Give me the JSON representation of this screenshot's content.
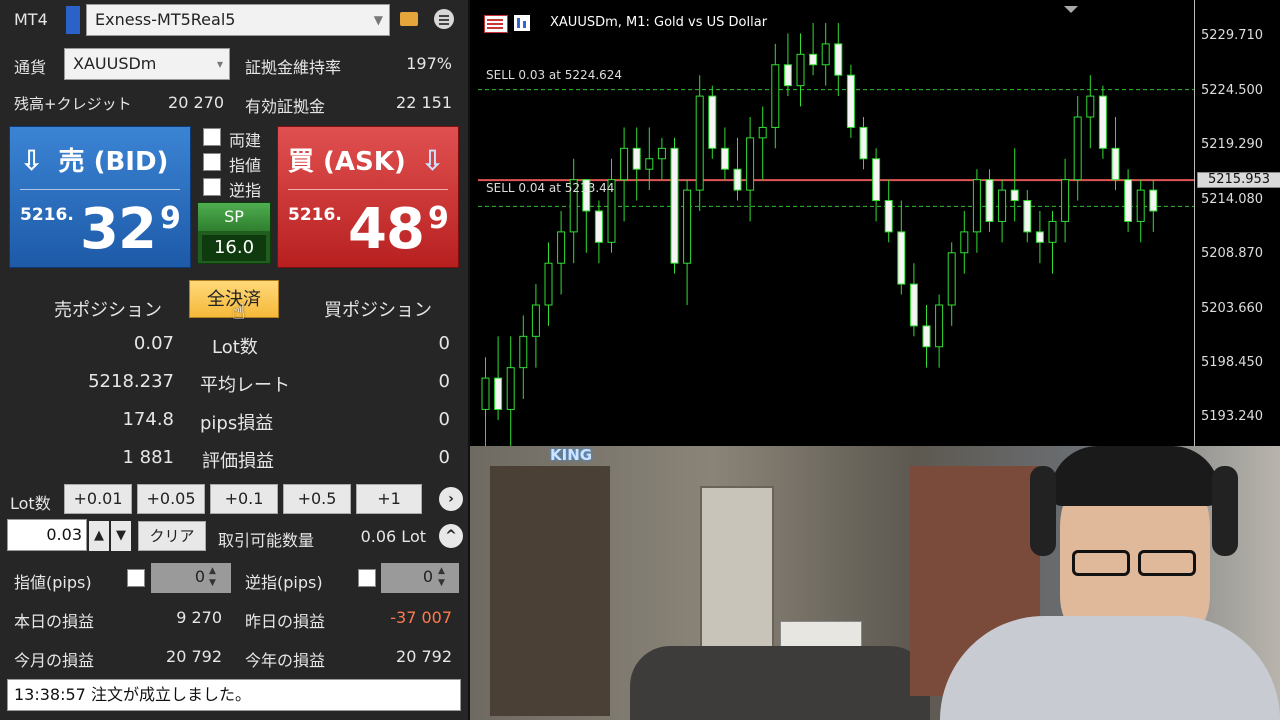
{
  "panel": {
    "app_label": "MT4",
    "account": "Exness-MT5Real5",
    "currency_label": "通貨",
    "symbol": "XAUUSDm",
    "margin_rate_label": "証拠金維持率",
    "margin_rate": "197%",
    "balance_label": "残高+クレジット",
    "balance": "20 270",
    "effective_margin_label": "有効証拠金",
    "effective_margin": "22 151",
    "bid": {
      "title": "売 (BID)",
      "small": "5216.",
      "big": "32",
      "sup": "9"
    },
    "ask": {
      "title": "買 (ASK)",
      "small": "5216.",
      "big": "48",
      "sup": "9"
    },
    "options": [
      {
        "label": "両建",
        "checked": false
      },
      {
        "label": "指値",
        "checked": false
      },
      {
        "label": "逆指",
        "checked": false
      }
    ],
    "spread": {
      "label": "SP",
      "value": "16.0"
    },
    "close_all": "全決済",
    "sell_position_label": "売ポジション",
    "buy_position_label": "買ポジション",
    "position_rows": [
      {
        "sell": "0.07",
        "label": "Lot数",
        "buy": "0"
      },
      {
        "sell": "5218.237",
        "label": "平均レート",
        "buy": "0"
      },
      {
        "sell": "174.8",
        "label": "pips損益",
        "buy": "0"
      },
      {
        "sell": "1 881",
        "label": "評価損益",
        "buy": "0"
      }
    ],
    "lot_label": "Lot数",
    "lot_buttons": [
      "+0.01",
      "+0.05",
      "+0.1",
      "+0.5",
      "+1"
    ],
    "lot_value": "0.03",
    "clear_label": "クリア",
    "tradable_label": "取引可能数量",
    "tradable_value": "0.06 Lot",
    "limit_label": "指値(pips)",
    "limit_value": "0",
    "stop_label": "逆指(pips)",
    "stop_value": "0",
    "today_pl_label": "本日の損益",
    "today_pl": "9 270",
    "yesterday_pl_label": "昨日の損益",
    "yesterday_pl": "-37 007",
    "month_pl_label": "今月の損益",
    "month_pl": "20 792",
    "year_pl_label": "今年の損益",
    "year_pl": "20 792",
    "status": "13:38:57 注文が成立しました。",
    "colors": {
      "negative": "#ff7a4d",
      "bid": "#1d5aa8",
      "ask": "#b82020"
    }
  },
  "chart": {
    "title": "XAUUSDm, M1:  Gold vs US Dollar",
    "order_lines": [
      {
        "label": "SELL 0.03 at 5224.624",
        "price": 5224.624
      },
      {
        "label": "SELL 0.04 at 5213.44",
        "price": 5213.44
      }
    ],
    "current_price_label": "5215.953",
    "chart_data": {
      "type": "candlestick",
      "y_ticks": [
        "5229.710",
        "5224.500",
        "5219.290",
        "5214.080",
        "5208.870",
        "5203.660",
        "5198.450",
        "5193.240"
      ],
      "ylim": [
        5190.5,
        5233.2
      ],
      "current_price": 5215.953,
      "candles": [
        [
          5194,
          5199,
          5190,
          5197
        ],
        [
          5197,
          5201,
          5193,
          5194
        ],
        [
          5194,
          5201,
          5190,
          5198
        ],
        [
          5198,
          5203,
          5195,
          5201
        ],
        [
          5201,
          5206,
          5198,
          5204
        ],
        [
          5204,
          5210,
          5202,
          5208
        ],
        [
          5208,
          5213,
          5205,
          5211
        ],
        [
          5211,
          5218,
          5208,
          5216
        ],
        [
          5216,
          5216,
          5209,
          5213
        ],
        [
          5213,
          5214,
          5208,
          5210
        ],
        [
          5210,
          5218,
          5209,
          5216
        ],
        [
          5216,
          5221,
          5212,
          5219
        ],
        [
          5219,
          5221,
          5214,
          5217
        ],
        [
          5217,
          5221,
          5215,
          5218
        ],
        [
          5218,
          5220,
          5216,
          5219
        ],
        [
          5219,
          5220,
          5207,
          5208
        ],
        [
          5208,
          5216,
          5204,
          5215
        ],
        [
          5215,
          5226,
          5213,
          5224
        ],
        [
          5224,
          5225,
          5218,
          5219
        ],
        [
          5219,
          5221,
          5216,
          5217
        ],
        [
          5217,
          5220,
          5214,
          5215
        ],
        [
          5215,
          5222,
          5212,
          5220
        ],
        [
          5220,
          5223,
          5216,
          5221
        ],
        [
          5221,
          5229,
          5219,
          5227
        ],
        [
          5227,
          5230,
          5224,
          5225
        ],
        [
          5225,
          5230,
          5223,
          5228
        ],
        [
          5228,
          5231,
          5226,
          5227
        ],
        [
          5227,
          5231,
          5225,
          5229
        ],
        [
          5229,
          5231,
          5224,
          5226
        ],
        [
          5226,
          5227,
          5220,
          5221
        ],
        [
          5221,
          5222,
          5217,
          5218
        ],
        [
          5218,
          5219,
          5212,
          5214
        ],
        [
          5214,
          5216,
          5210,
          5211
        ],
        [
          5211,
          5214,
          5205,
          5206
        ],
        [
          5206,
          5208,
          5201,
          5202
        ],
        [
          5202,
          5204,
          5198,
          5200
        ],
        [
          5200,
          5205,
          5198,
          5204
        ],
        [
          5204,
          5210,
          5202,
          5209
        ],
        [
          5209,
          5213,
          5207,
          5211
        ],
        [
          5211,
          5217,
          5209,
          5216
        ],
        [
          5216,
          5217,
          5211,
          5212
        ],
        [
          5212,
          5216,
          5210,
          5215
        ],
        [
          5215,
          5219,
          5212,
          5214
        ],
        [
          5214,
          5215,
          5210,
          5211
        ],
        [
          5211,
          5213,
          5208,
          5210
        ],
        [
          5210,
          5213,
          5207,
          5212
        ],
        [
          5212,
          5218,
          5210,
          5216
        ],
        [
          5216,
          5224,
          5214,
          5222
        ],
        [
          5222,
          5226,
          5219,
          5224
        ],
        [
          5224,
          5225,
          5218,
          5219
        ],
        [
          5219,
          5222,
          5215,
          5216
        ],
        [
          5216,
          5217,
          5211,
          5212
        ],
        [
          5212,
          5216,
          5210,
          5215
        ],
        [
          5215,
          5216,
          5211,
          5213
        ]
      ]
    }
  },
  "video": {
    "sign_text": "KING"
  }
}
